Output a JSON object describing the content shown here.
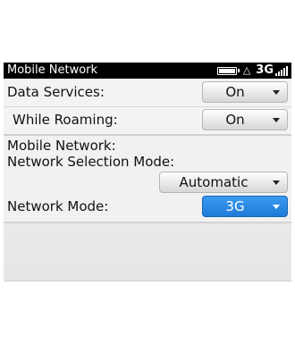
{
  "status_bar": {
    "title": "Mobile Network",
    "warning_icon": "warning-icon",
    "network_type": "3G",
    "battery_icon": "battery-icon",
    "signal_icon": "signal-strength-icon"
  },
  "settings": {
    "data_services": {
      "label": "Data Services:",
      "value": "On"
    },
    "while_roaming": {
      "label": "While Roaming:",
      "value": "On"
    },
    "section_label": "Mobile Network:",
    "network_selection": {
      "label": "Network Selection Mode:",
      "value": "Automatic"
    },
    "network_mode": {
      "label": "Network Mode:",
      "value": "3G"
    }
  },
  "colors": {
    "status_bar": "#000000",
    "selected_dropdown": "#2a8be6"
  }
}
